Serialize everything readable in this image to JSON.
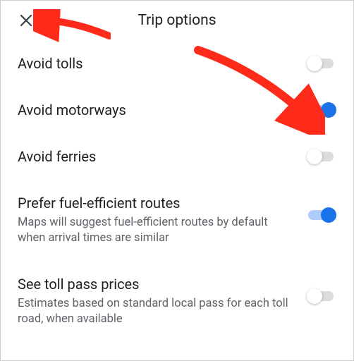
{
  "header": {
    "title": "Trip options"
  },
  "options": [
    {
      "label": "Avoid tolls",
      "sub": null,
      "on": false
    },
    {
      "label": "Avoid motorways",
      "sub": null,
      "on": true
    },
    {
      "label": "Avoid ferries",
      "sub": null,
      "on": false
    },
    {
      "label": "Prefer fuel-efficient routes",
      "sub": "Maps will suggest fuel-efficient routes by default when arrival times are similar",
      "on": true
    },
    {
      "label": "See toll pass prices",
      "sub": "Estimates based on standard local pass for each toll road, when available",
      "on": false
    }
  ],
  "annotations": {
    "arrow_to_close": true,
    "arrow_to_motorways_toggle": true,
    "arrow_color": "#ff2b1a"
  }
}
